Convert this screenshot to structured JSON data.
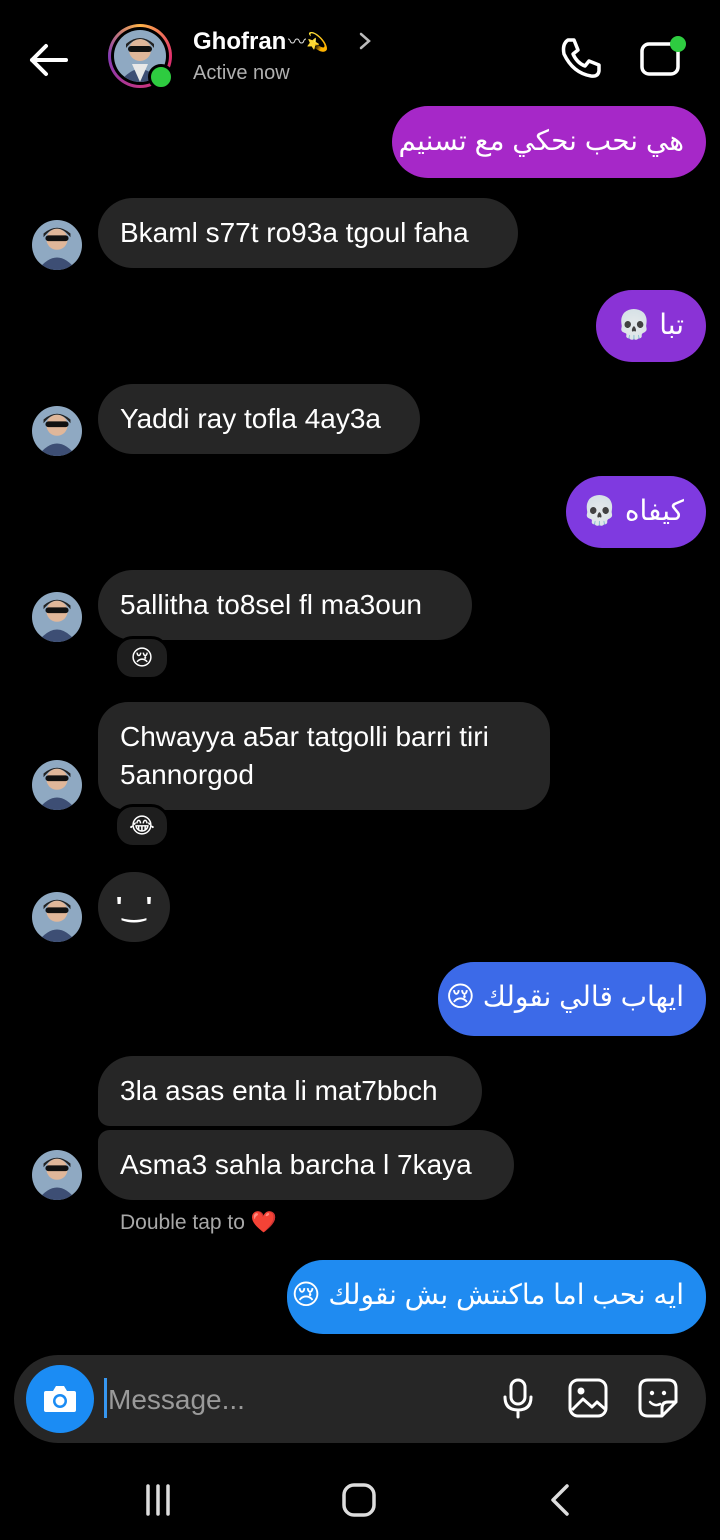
{
  "header": {
    "name": "Ghofran",
    "name_decoration": "〰💫",
    "status": "Active now"
  },
  "colors": {
    "sent_purple": "#a628c8",
    "sent_violet": "#8a33d6",
    "sent_indigo": "#7f3ae0",
    "sent_blue": "#3c6ae8",
    "sent_brightblue": "#1f8bf1",
    "received": "#262626",
    "online": "#2ecc40",
    "camera_button": "#1b8cf4"
  },
  "messages": [
    {
      "side": "sent",
      "text": "هي نحب نحكي مع تسنيم"
    },
    {
      "side": "received",
      "text": "Bkaml s77t ro93a tgoul faha"
    },
    {
      "side": "sent",
      "text": "تبا 💀"
    },
    {
      "side": "received",
      "text": "Yaddi ray tofla 4ay3a"
    },
    {
      "side": "sent",
      "text": "كيفاه 💀"
    },
    {
      "side": "received",
      "text": "5allitha to8sel fl ma3oun",
      "reaction": "😢"
    },
    {
      "side": "received",
      "text_line1": "Chwayya a5ar tatgolli barri tiri",
      "text_line2": "5annorgod",
      "reaction": "😂"
    },
    {
      "side": "received",
      "text": "'‿'"
    },
    {
      "side": "sent",
      "text": "ايهاب قالي نقولك 😢"
    },
    {
      "side": "received",
      "text": "3la asas enta li mat7bbch"
    },
    {
      "side": "received",
      "text": "Asma3 sahla barcha l 7kaya"
    },
    {
      "side": "sent",
      "text": "ايه نحب اما ماكنتش بش نقولك 😢"
    }
  ],
  "double_tap_hint": "Double tap to ❤️",
  "composer": {
    "placeholder": "Message..."
  }
}
